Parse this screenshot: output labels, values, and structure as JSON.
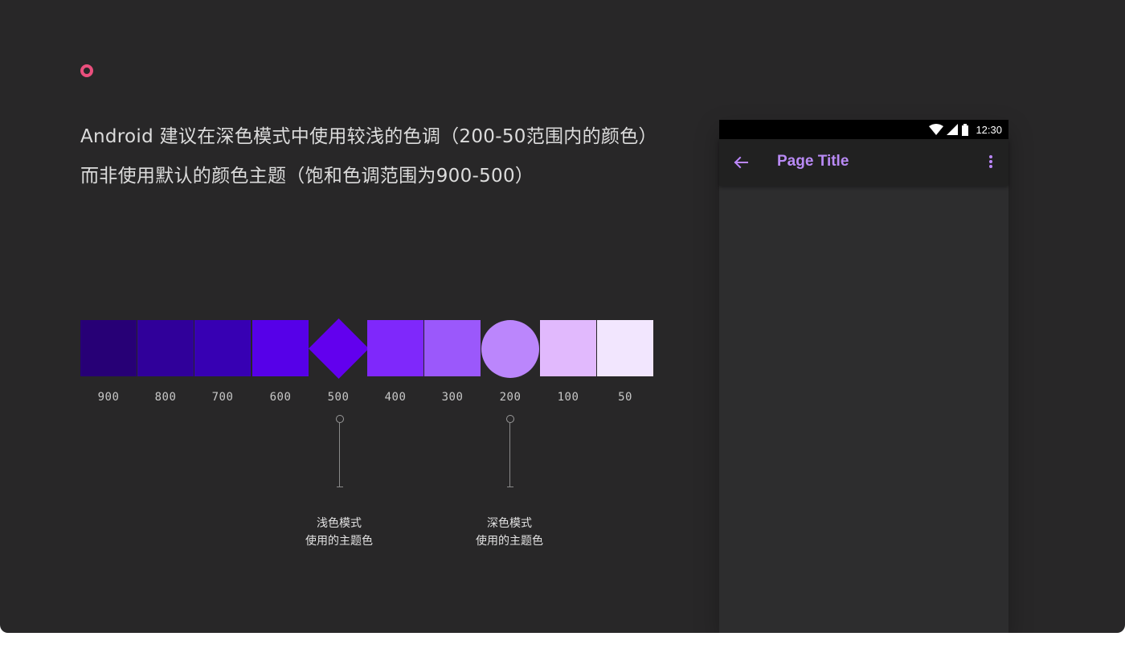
{
  "headline": {
    "line1": "Android 建议在深色模式中使用较浅的色调（200-50范围内的颜色）",
    "line2": "而非使用默认的颜色主题（饱和色调范围为900-500）"
  },
  "palette": {
    "swatches": [
      {
        "label": "900",
        "color": "#270076"
      },
      {
        "label": "800",
        "color": "#30009a"
      },
      {
        "label": "700",
        "color": "#3700b3"
      },
      {
        "label": "600",
        "color": "#5600e8"
      },
      {
        "label": "500",
        "color": "#6200ee"
      },
      {
        "label": "400",
        "color": "#7f28fb"
      },
      {
        "label": "300",
        "color": "#9b58fb"
      },
      {
        "label": "200",
        "color": "#bb86fc"
      },
      {
        "label": "100",
        "color": "#e1b9fd"
      },
      {
        "label": "50",
        "color": "#f2e6fe"
      }
    ]
  },
  "callouts": {
    "light_mode": {
      "line1": "浅色模式",
      "line2": "使用的主题色"
    },
    "dark_mode": {
      "line1": "深色模式",
      "line2": "使用的主题色"
    }
  },
  "phone": {
    "status_time": "12:30",
    "page_title": "Page Title",
    "accent_color": "#bb86fc"
  },
  "colors": {
    "background": "#282728",
    "marker": "#ea4f7d"
  }
}
